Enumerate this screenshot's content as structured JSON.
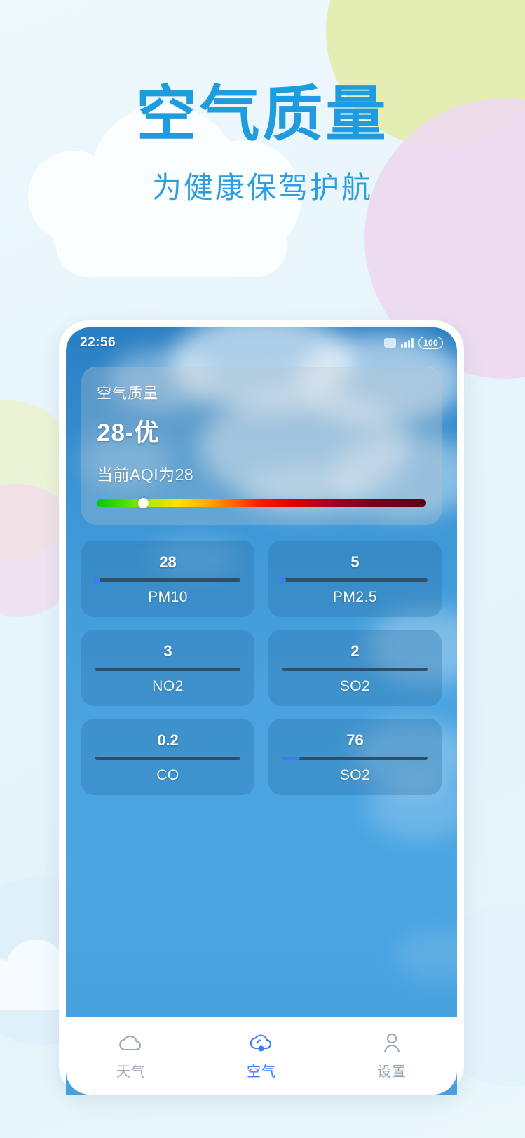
{
  "hero": {
    "title": "空气质量",
    "subtitle": "为健康保驾护航",
    "title_color": "#1f9be0"
  },
  "statusbar": {
    "time": "22:56",
    "battery": "100",
    "icons": [
      "screenshot-icon",
      "signal-icon",
      "battery-icon"
    ]
  },
  "aqi_card": {
    "label": "空气质量",
    "value": "28-优",
    "description": "当前AQI为28",
    "bar_position_pct": 14
  },
  "metrics": [
    {
      "value": "28",
      "name": "PM10",
      "fill_pct": 0,
      "dot_pct": 1,
      "has_dot": true
    },
    {
      "value": "5",
      "name": "PM2.5",
      "fill_pct": 0,
      "dot_pct": 0,
      "has_dot": true
    },
    {
      "value": "3",
      "name": "NO2",
      "fill_pct": 0,
      "dot_pct": 0,
      "has_dot": false
    },
    {
      "value": "2",
      "name": "SO2",
      "fill_pct": 0,
      "dot_pct": 0,
      "has_dot": false
    },
    {
      "value": "0.2",
      "name": "CO",
      "fill_pct": 0,
      "dot_pct": 0,
      "has_dot": false
    },
    {
      "value": "76",
      "name": "SO2",
      "fill_pct": 12,
      "dot_pct": 10,
      "has_dot": false
    }
  ],
  "tabbar": {
    "items": [
      {
        "label": "天气",
        "icon": "cloud-icon",
        "active": false
      },
      {
        "label": "空气",
        "icon": "cloud-dot-icon",
        "active": true
      },
      {
        "label": "设置",
        "icon": "person-icon",
        "active": false
      }
    ],
    "active_color": "#3c7df0",
    "inactive_color": "#9aa7b3"
  }
}
